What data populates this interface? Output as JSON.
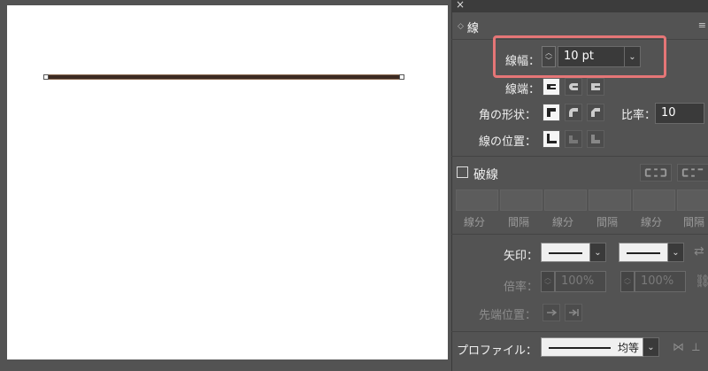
{
  "panel": {
    "close_icon": "×",
    "tab_title": "線",
    "menu_icon": "≡"
  },
  "stroke": {
    "weight_label": "線幅：",
    "weight_value": "10 pt",
    "cap_label": "線端：",
    "corner_label": "角の形状：",
    "limit_label": "比率：",
    "limit_value": "10",
    "align_label": "線の位置："
  },
  "dashed": {
    "checkbox_label": "破線",
    "field_labels": [
      "線分",
      "間隔",
      "線分",
      "間隔",
      "線分",
      "間隔"
    ]
  },
  "arrowheads": {
    "label": "矢印：",
    "scale_label": "倍率：",
    "scale_start": "100%",
    "scale_end": "100%",
    "align_label": "先端位置："
  },
  "profile": {
    "label": "プロファイル：",
    "value": "均等"
  },
  "colors": {
    "highlight": "#e57677",
    "stroke_line": "#3b2a22"
  }
}
